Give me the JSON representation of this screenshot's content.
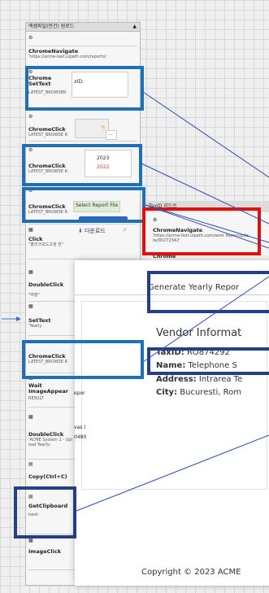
{
  "panel": {
    "header": "액셈파일(먼건) 원로드",
    "steps": [
      {
        "icon": "⚙",
        "title": "",
        "sub": ""
      },
      {
        "icon": "⚙",
        "title": "ChromeNavigate",
        "sub": "'https://acme-test.uipath.com/reports/"
      },
      {
        "icon": "⚙",
        "title": "Chrome SetText",
        "sub": "LATEST_BROWSER"
      },
      {
        "icon": "⚙",
        "title": "ChromeClick",
        "sub": "LATEST_BROWSE R"
      },
      {
        "icon": "⚙",
        "title": "ChromeClick",
        "sub": "LATEST_BROWSE R"
      },
      {
        "icon": "⚙",
        "title": "ChromeClick",
        "sub": "LATEST_BROWSE R"
      },
      {
        "icon": "▦",
        "title": "Click",
        "sub": "\"클리크보드고생 한\""
      },
      {
        "icon": "▦",
        "title": "DoubleClick",
        "sub": "\"여정\""
      },
      {
        "icon": "▦",
        "title": "SetText",
        "sub": "'Yearly"
      },
      {
        "icon": "⚙",
        "title": "ChromeClick",
        "sub": "LATEST_BROWSE R"
      },
      {
        "icon": "▦",
        "title": "Wait ImageAppear",
        "sub": "RESULT"
      },
      {
        "icon": "▦",
        "title": "DoubleClick",
        "sub": "'ACME System 1 - Upload Yearly-"
      },
      {
        "icon": "▤",
        "title": "Copy(Ctrl+C)",
        "sub": ""
      },
      {
        "icon": "▤",
        "title": "GetClipboard",
        "sub": "hash"
      },
      {
        "icon": "▦",
        "title": "ImageClick",
        "sub": ""
      }
    ]
  },
  "thumbs": {
    "taxid": "xID:",
    "year_2023": "2023",
    "year_2022": "2022",
    "select_report": "Select Report File",
    "download": "다운로드",
    "wait_partial": "epor",
    "dbl_partial1": "vas (",
    "dbl_partial2": "0480"
  },
  "right_panel": {
    "header": "TaxID 리드쓰",
    "nav_title": "ChromeNavigate",
    "nav_url": "'https://acme-test.uipath.com/work items/update/90272342'",
    "next_title": "Chrome"
  },
  "browser": {
    "tab_title": "Generate Yearly Repor",
    "heading": "Vendor Informat",
    "taxid_label": "TaxID:",
    "taxid_value": "RO874292",
    "name_label": "Name:",
    "name_value": "Telephone S",
    "address_label": "Address:",
    "address_value": "Intrarea Te",
    "city_label": "City:",
    "city_value": "Bucuresti, Rom",
    "footer": "Copyright © 2023 ACME"
  },
  "colors": {
    "highlight_blue": "#1f6fb5",
    "highlight_navy": "#233f86",
    "highlight_red": "#e01010"
  }
}
